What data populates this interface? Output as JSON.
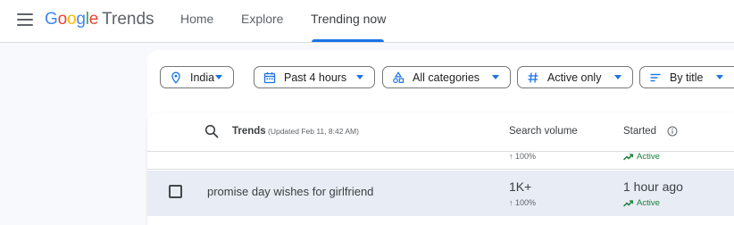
{
  "header": {
    "logo": {
      "letters": [
        "G",
        "o",
        "o",
        "g",
        "l",
        "e"
      ],
      "letter_colors": [
        "#4285f4",
        "#ea4335",
        "#fbbc04",
        "#4285f4",
        "#34a853",
        "#ea4335"
      ],
      "product": "Trends"
    },
    "nav": [
      {
        "label": "Home",
        "active": false
      },
      {
        "label": "Explore",
        "active": false
      },
      {
        "label": "Trending now",
        "active": true
      }
    ]
  },
  "filters": [
    {
      "label": "India",
      "icon": "location-pin-icon"
    },
    {
      "label": "Past 4 hours",
      "icon": "calendar-icon"
    },
    {
      "label": "All categories",
      "icon": "categories-shapes-icon"
    },
    {
      "label": "Active only",
      "icon": "hashtag-icon"
    },
    {
      "label": "By title",
      "icon": "sort-lines-icon"
    }
  ],
  "table": {
    "columns": {
      "trends": "Trends",
      "updated": "(Updated Feb 11, 8:42 AM)",
      "search_volume": "Search volume",
      "started": "Started"
    },
    "partial_row": {
      "volume_change": "↑ 100%",
      "status": "Active"
    },
    "rows": [
      {
        "title": "promise day wishes for girlfriend",
        "search_volume": "1K+",
        "volume_change": "↑ 100%",
        "started": "1 hour ago",
        "status": "Active"
      }
    ]
  },
  "colors": {
    "accent": "#1a73e8",
    "active_green": "#188038",
    "row_highlight": "#e8ecf4",
    "page_background": "#f8f9fc"
  }
}
